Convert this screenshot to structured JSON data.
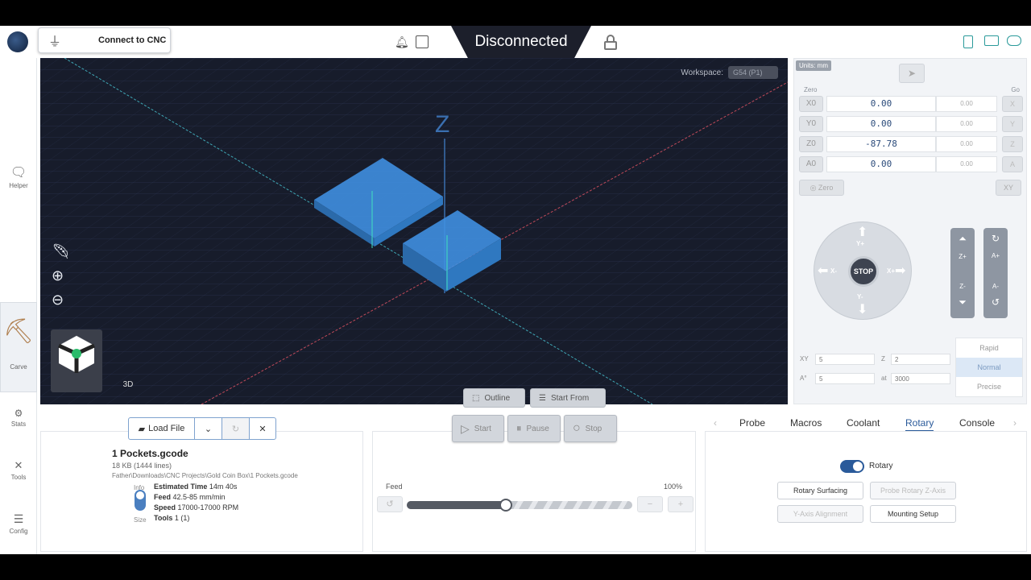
{
  "topbar": {
    "connect_label": "Connect to CNC",
    "status": "Disconnected"
  },
  "nav": {
    "helper": "Helper",
    "carve": "Carve",
    "stats": "Stats",
    "tools": "Tools",
    "config": "Config"
  },
  "viewport": {
    "workspace_label": "Workspace:",
    "workspace_value": "G54 (P1)",
    "z_axis_label": "Z",
    "cube_label": "3D",
    "outline_label": "Outline",
    "start_from_label": "Start From"
  },
  "dro": {
    "units": "Units: mm",
    "zero_header": "Zero",
    "go_header": "Go",
    "axes": [
      {
        "zero_btn": "X0",
        "value": "0.00",
        "machine": "0.00",
        "go_btn": "X"
      },
      {
        "zero_btn": "Y0",
        "value": "0.00",
        "machine": "0.00",
        "go_btn": "Y"
      },
      {
        "zero_btn": "Z0",
        "value": "-87.78",
        "machine": "0.00",
        "go_btn": "Z"
      },
      {
        "zero_btn": "A0",
        "value": "0.00",
        "machine": "0.00",
        "go_btn": "A"
      }
    ],
    "zero_all": "Zero",
    "go_xy": "XY",
    "jog": {
      "stop": "STOP",
      "yplus": "Y+",
      "yminus": "Y-",
      "xplus": "X+",
      "xminus": "X-"
    },
    "zplus": "Z+",
    "zminus": "Z-",
    "aplus": "A+",
    "aminus": "A-",
    "xy_label": "XY",
    "xy_value": "5",
    "z_label": "Z",
    "z_value": "2",
    "a_label": "A°",
    "a_value": "5",
    "at_label": "at",
    "at_value": "3000",
    "speeds": [
      "Rapid",
      "Normal",
      "Precise"
    ]
  },
  "file": {
    "load_label": "Load File",
    "name": "1 Pockets.gcode",
    "size": "18 KB (1444 lines)",
    "path": "Father\\Downloads\\CNC Projects\\Gold Coin Box\\1 Pockets.gcode",
    "info_tab": "Info",
    "size_tab": "Size",
    "est_time_label": "Estimated Time",
    "est_time": "14m 40s",
    "feed_label": "Feed",
    "feed": "42.5-85 mm/min",
    "speed_label": "Speed",
    "speed": "17000-17000 RPM",
    "tools_label": "Tools",
    "tools": "1 (1)"
  },
  "controls": {
    "start": "Start",
    "pause": "Pause",
    "stop": "Stop",
    "feed_label": "Feed",
    "feed_pct": "100%",
    "feed_fraction": 0.44
  },
  "tabs": [
    "Probe",
    "Macros",
    "Coolant",
    "Rotary",
    "Console"
  ],
  "rotary": {
    "toggle_label": "Rotary",
    "surfacing": "Rotary Surfacing",
    "probe_z": "Probe Rotary Z-Axis",
    "y_align": "Y-Axis Alignment",
    "mounting": "Mounting Setup"
  },
  "colors": {
    "accent": "#2a5a9a",
    "viewport_bg": "#171c2b",
    "part_blue": "#3f8fe0"
  }
}
